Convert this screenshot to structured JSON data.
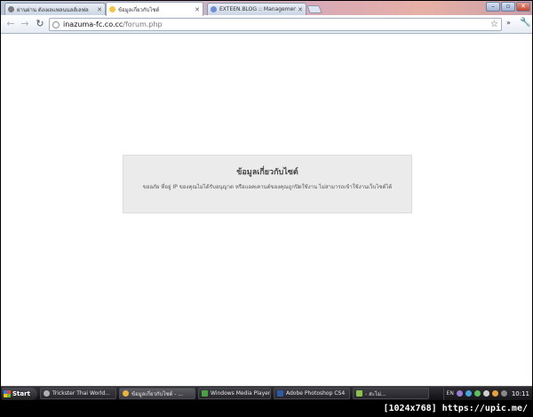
{
  "browser": {
    "tabs": [
      {
        "label": "ผ่านผ่าน ดังเผลแพลนนลส์เลฟล",
        "active": false
      },
      {
        "label": "ข้อมูลเกี่ยวกับไซต์",
        "active": true
      },
      {
        "label": "EXTEEN.BLOG :: Management",
        "active": false
      }
    ],
    "url_host": "inazuma-fc.co.cc",
    "url_path": "/forum.php"
  },
  "page": {
    "title": "ข้อมูลเกี่ยวกับไซต์",
    "message": "ขออภัย ที่อยู่ IP ของคุณไม่ได้รับอนุญาต หรือแอคเคานต์ของคุณถูกปิดใช้งาน ไม่สามารถเข้าใช้งานเว็บไซต์ได้"
  },
  "taskbar": {
    "start_label": "Start",
    "tasks": [
      {
        "label": "Trickster Thai World..."
      },
      {
        "label": "ข้อมูลเกี่ยวกับไซต์ - ..."
      },
      {
        "label": "Windows Media Player"
      },
      {
        "label": "Adobe Photoshop CS4"
      },
      {
        "label": "- สะไม่..."
      }
    ],
    "language": "EN",
    "clock": "10:11"
  },
  "watermark": "[1024x768] https://upic.me/",
  "colors": {
    "message_box_bg": "#ebebeb",
    "taskbar_bg": "#111114"
  }
}
